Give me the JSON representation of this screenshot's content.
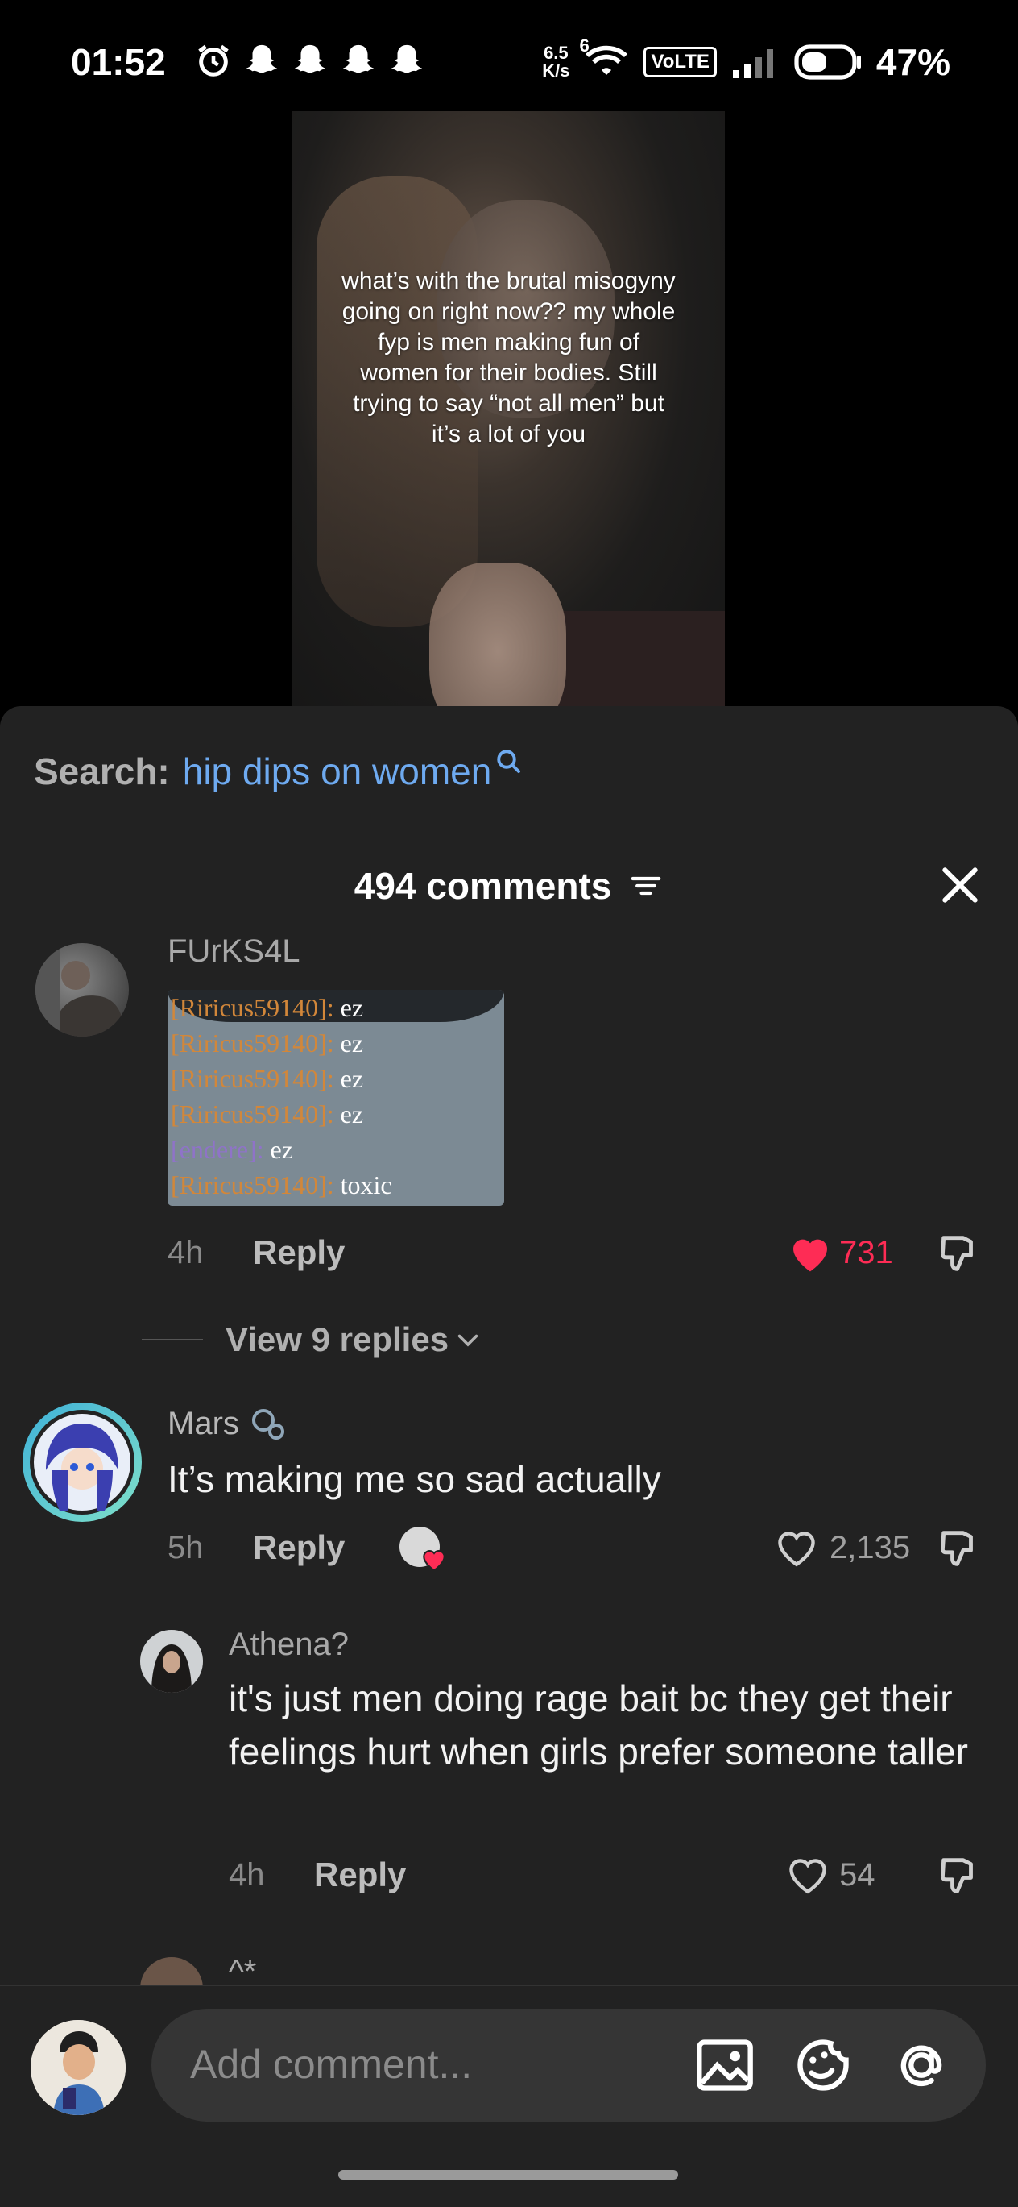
{
  "status": {
    "time": "01:52",
    "netspeed_top": "6.5",
    "netspeed_bottom": "K/s",
    "wifi_badge": "6",
    "volte": "VoLTE",
    "battery": "47%"
  },
  "video": {
    "caption": "what’s with the brutal misogyny going on right now?? my whole fyp is men making fun of women for their bodies. Still trying to say “not all men” but it’s a lot of you"
  },
  "search": {
    "label": "Search:",
    "query": "hip dips on women"
  },
  "comments_header": {
    "title": "494 comments"
  },
  "comments": [
    {
      "username": "FUrKS4L",
      "image_chat": [
        {
          "name": "[Riricus59140]:",
          "msg": "ez"
        },
        {
          "name": "[Riricus59140]:",
          "msg": "ez"
        },
        {
          "name": "[Riricus59140]:",
          "msg": "ez"
        },
        {
          "name": "[Riricus59140]:",
          "msg": "ez"
        },
        {
          "name": "[endere]:",
          "msg": "ez"
        },
        {
          "name": "[Riricus59140]:",
          "msg": "toxic"
        }
      ],
      "time": "4h",
      "reply": "Reply",
      "likes": "731",
      "view_replies": "View 9 replies"
    },
    {
      "username": "Mars",
      "text": "It’s making me so sad actually",
      "time": "5h",
      "reply": "Reply",
      "likes": "2,135"
    },
    {
      "username": "Athena?",
      "text": "it's just men doing rage bait bc they get their feelings hurt when girls prefer someone taller",
      "time": "4h",
      "reply": "Reply",
      "likes": "54"
    },
    {
      "username": "^*"
    }
  ],
  "composer": {
    "placeholder": "Add comment..."
  },
  "colors": {
    "sheet_bg": "#222222",
    "link_blue": "#6eaaf0",
    "like_red": "#fe2c55"
  }
}
